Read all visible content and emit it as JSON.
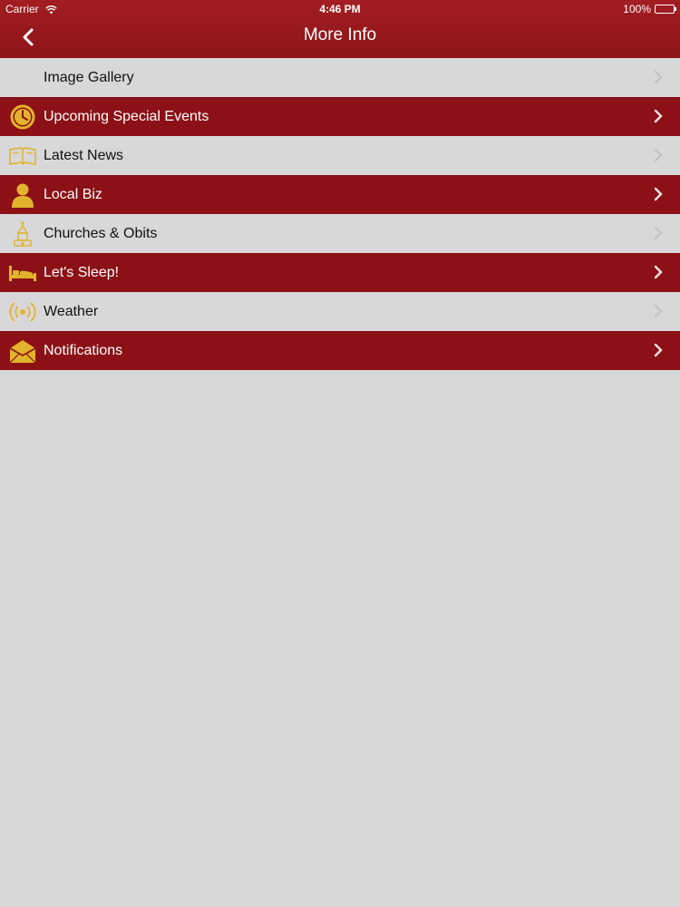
{
  "status_bar": {
    "carrier": "Carrier",
    "time": "4:46 PM",
    "battery": "100%"
  },
  "nav": {
    "title": "More Info",
    "back_icon": "chevron-left-icon"
  },
  "colors": {
    "accent": "#8b1116",
    "gold": "#e2b32c",
    "background": "#d8d7d9"
  },
  "menu": {
    "items": [
      {
        "label": "Image Gallery",
        "icon": "none",
        "style": "light"
      },
      {
        "label": "Upcoming Special Events",
        "icon": "clock-icon",
        "style": "dark"
      },
      {
        "label": "Latest News",
        "icon": "newspaper-icon",
        "style": "light"
      },
      {
        "label": "Local Biz",
        "icon": "person-icon",
        "style": "dark"
      },
      {
        "label": "Churches & Obits",
        "icon": "church-icon",
        "style": "light"
      },
      {
        "label": "Let's Sleep!",
        "icon": "bed-icon",
        "style": "dark"
      },
      {
        "label": "Weather",
        "icon": "broadcast-icon",
        "style": "light"
      },
      {
        "label": "Notifications",
        "icon": "envelope-icon",
        "style": "dark"
      }
    ]
  }
}
